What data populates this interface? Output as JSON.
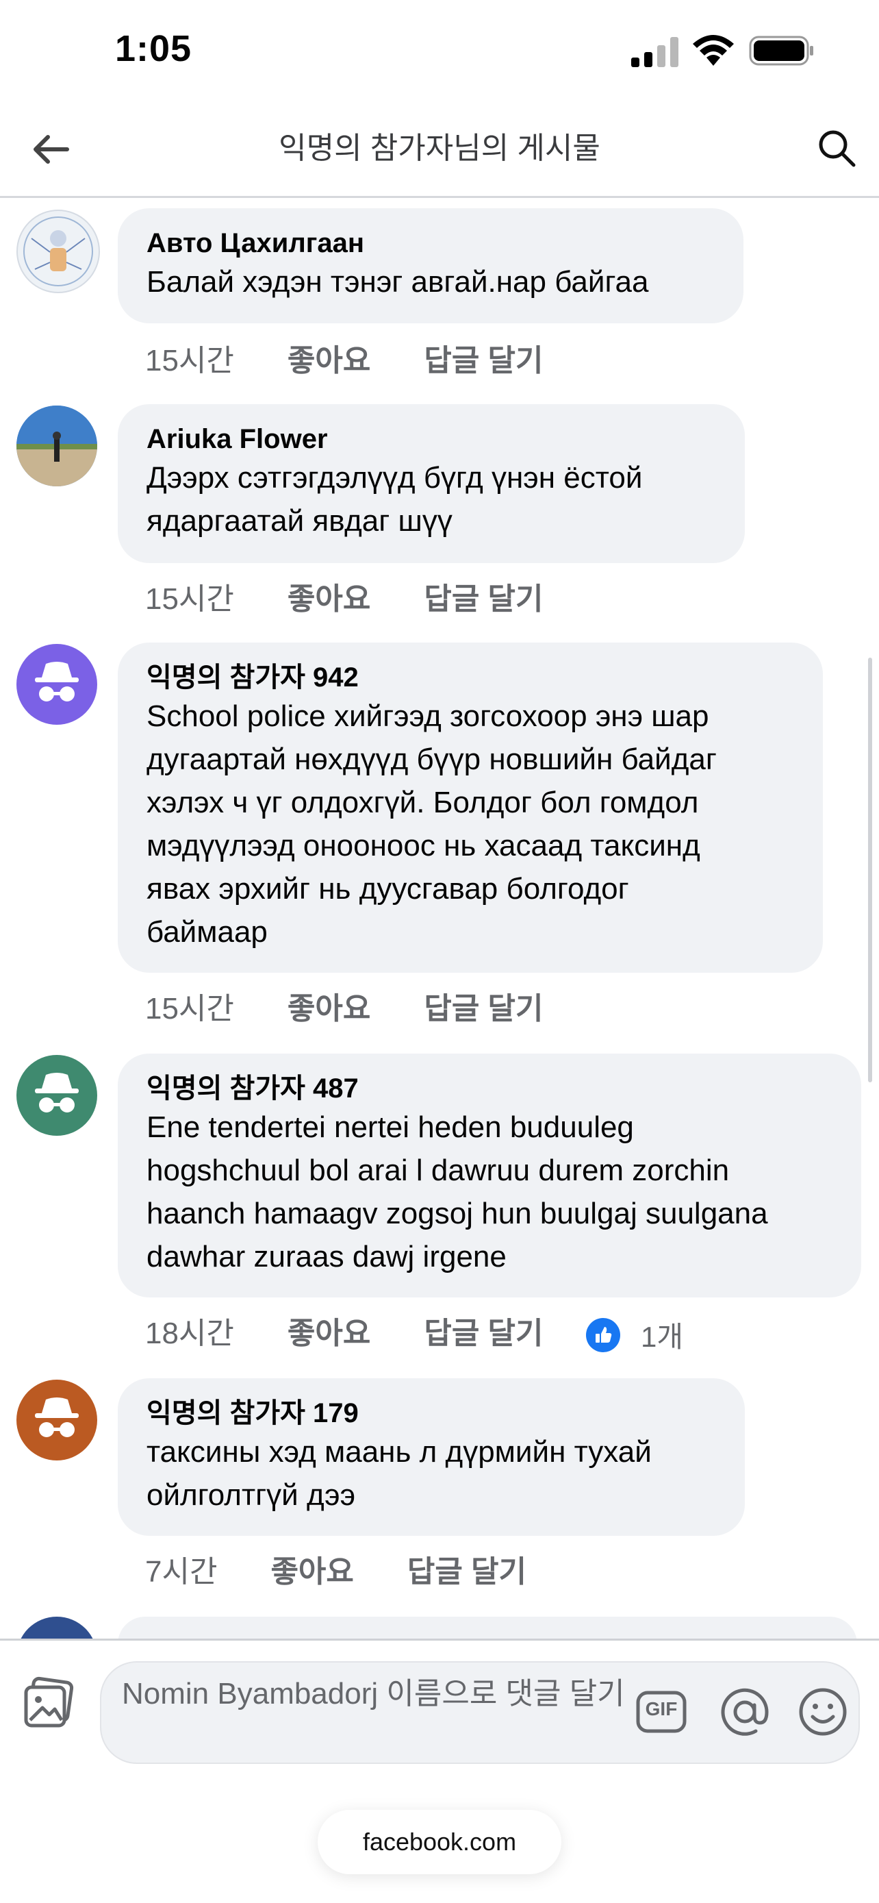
{
  "status_bar": {
    "time": "1:05"
  },
  "header": {
    "title": "익명의 참가자님의 게시물"
  },
  "comments": [
    {
      "author": "Авто Цахилгаан",
      "text": "Балай хэдэн тэнэг авгай.нар байгаа",
      "time": "15시간",
      "like_label": "좋아요",
      "reply_label": "답글 달기"
    },
    {
      "author": "Ariuka Flower",
      "text": "Дээрх сэтгэгдэлүүд бүгд үнэн ёстой\nядаргаатай явдаг шүү",
      "time": "15시간",
      "like_label": "좋아요",
      "reply_label": "답글 달기"
    },
    {
      "author": "익명의 참가자 942",
      "text": "School police хийгээд зогсохоор энэ шар\nдугаартай нөхдүүд бүүр новшийн байдаг\nхэлэх ч үг олдохгүй. Болдог бол гомдол\nмэдүүлээд оноонoос нь хасаад таксинд\nявах эрхийг нь дуусгавар болгодог\nбаймаар",
      "time": "15시간",
      "like_label": "좋아요",
      "reply_label": "답글 달기",
      "avatar_color": "#7b61e6"
    },
    {
      "author": "익명의 참가자 487",
      "text": "Ene tendertei nertei heden buduuleg\nhogshchuul bol arai l dawruu durem zorchin\nhaanch hamaagv zogsoj hun buulgaj suulgana\ndawhar zuraas dawj irgene",
      "time": "18시간",
      "like_label": "좋아요",
      "reply_label": "답글 달기",
      "reaction_count": "1개",
      "avatar_color": "#3f8a6f"
    },
    {
      "author": "익명의 참가자 179",
      "text": "таксины хэд маань л дүрмийн тухай\nойлголтгүй дээ",
      "time": "7시간",
      "like_label": "좋아요",
      "reply_label": "답글 달기",
      "avatar_color": "#bb5a22"
    }
  ],
  "composer": {
    "placeholder": "Nomin Byambadorj 이름으로 댓글 달기",
    "gif_label": "GIF"
  },
  "browser": {
    "url": "facebook.com"
  },
  "colors": {
    "accent": "#1877f2",
    "bubble": "#f0f2f5",
    "meta": "#65676b"
  }
}
